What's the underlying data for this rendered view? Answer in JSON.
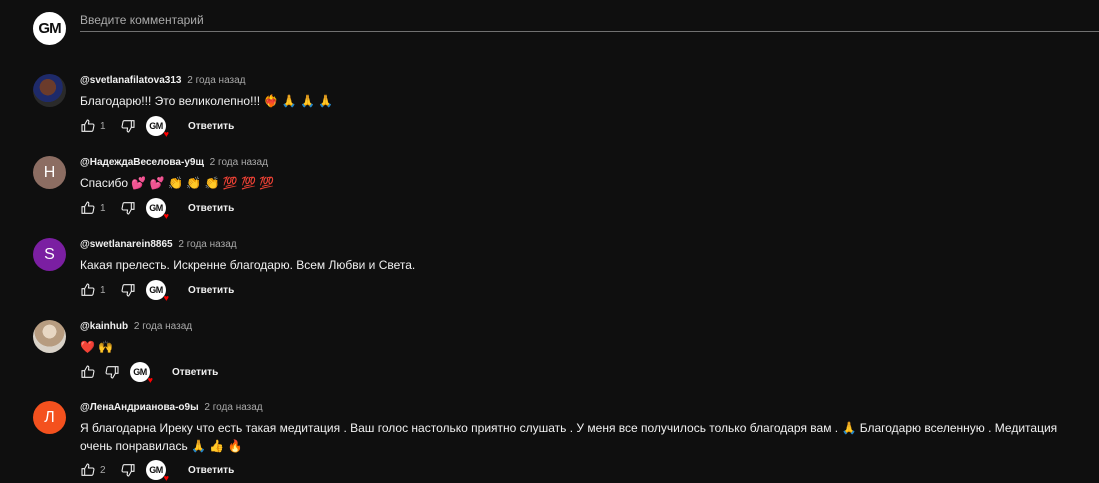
{
  "composer": {
    "placeholder": "Введите комментарий",
    "avatar_text": "GM"
  },
  "reply_label": "Ответить",
  "channel_logo_text": "GM",
  "colors": {
    "background": "#0f0f0f",
    "text_primary": "#f1f1f1",
    "text_secondary": "#aaaaaa",
    "heart_red": "#ff0000",
    "avatar_n": "#8c6d62",
    "avatar_s": "#7b1fa2",
    "avatar_l": "#f4511e"
  },
  "comments": [
    {
      "author": "@svetlanafilatova313",
      "time": "2 года назад",
      "text": "Благодарю!!! Это  великолепно!!! ❤️‍🔥 🙏 🙏 🙏",
      "likes": "1",
      "avatar_letter": ""
    },
    {
      "author": "@НадеждаВеселова-у9щ",
      "time": "2 года назад",
      "text": "Спасибо 💕 💕 👏 👏 👏 💯 💯 💯",
      "likes": "1",
      "avatar_letter": "Н"
    },
    {
      "author": "@swetlanarein8865",
      "time": "2 года назад",
      "text": "Какая прелесть. Искренне благодарю.  Всем Любви и Света.",
      "likes": "1",
      "avatar_letter": "S"
    },
    {
      "author": "@kainhub",
      "time": "2 года назад",
      "text": "❤️ 🙌",
      "likes": "",
      "avatar_letter": ""
    },
    {
      "author": "@ЛенаАндрианова-о9ы",
      "time": "2 года назад",
      "text": "Я благодарна Иреку что есть такая медитация . Ваш голос настолько приятно слушать . У меня все получилось только благодаря вам .  🙏  Благодарю вселенную . Медитация очень понравилась 🙏 👍 🔥",
      "likes": "2",
      "avatar_letter": "Л"
    }
  ],
  "icons": {
    "like": "thumbs-up-icon",
    "dislike": "thumbs-down-icon",
    "creator_heart": "creator-heart-icon"
  }
}
